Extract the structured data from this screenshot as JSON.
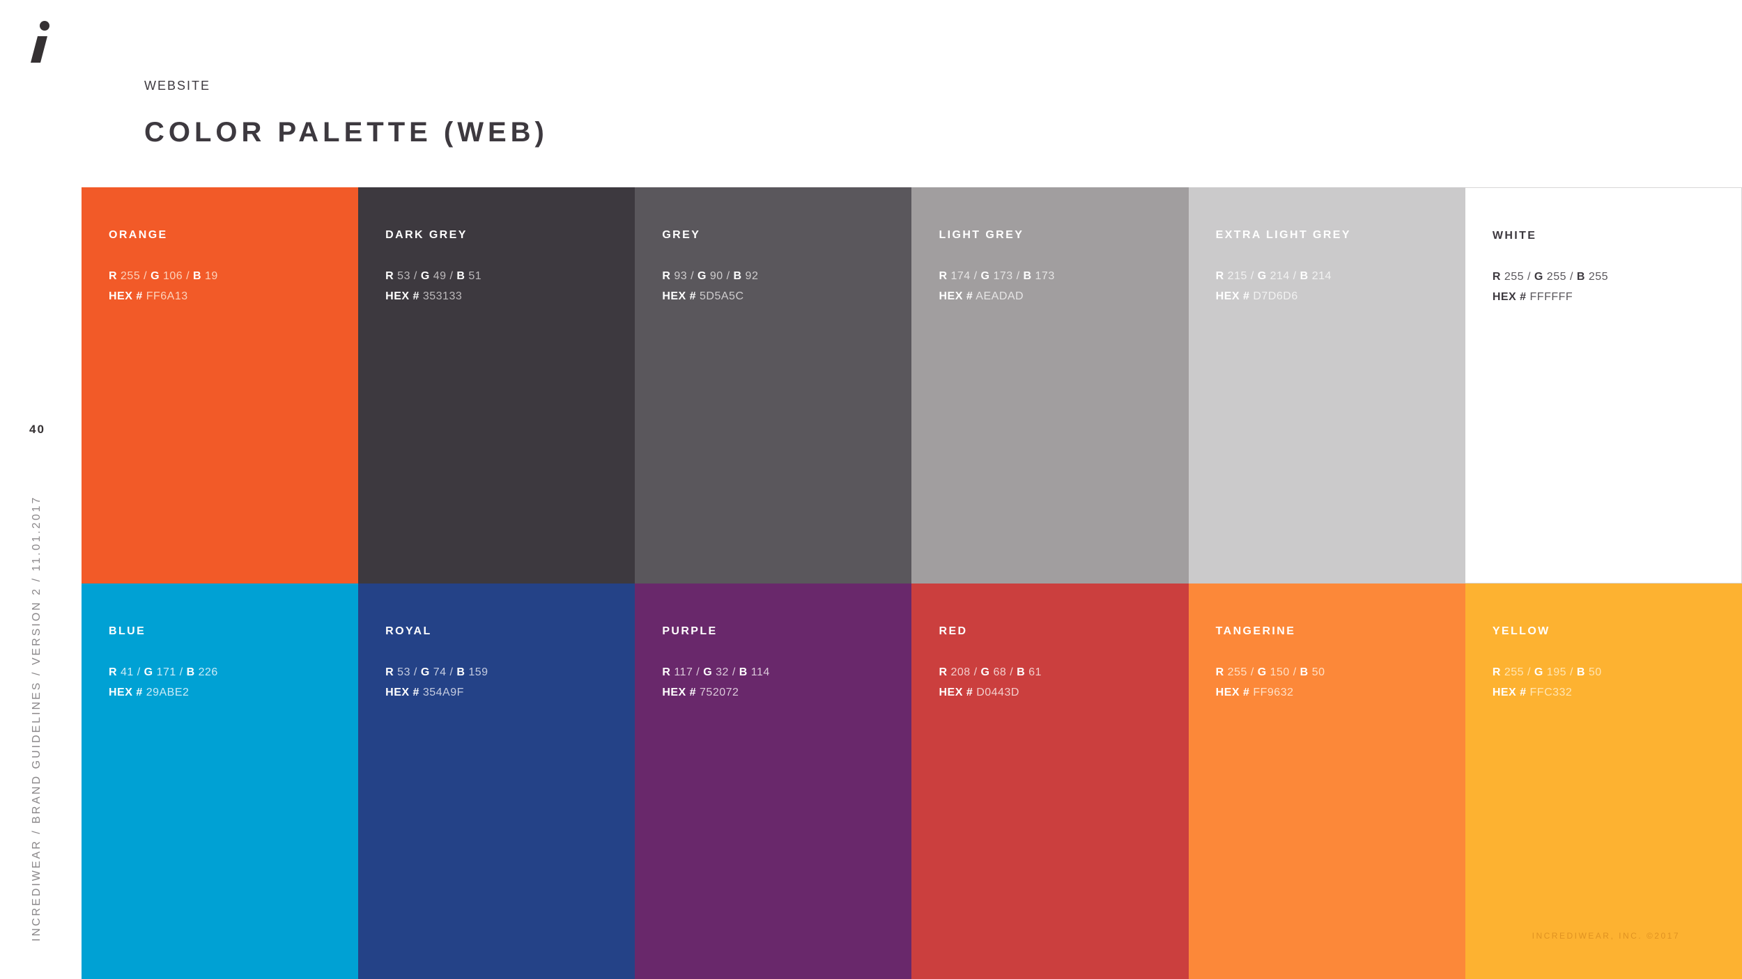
{
  "header": {
    "section_label": "WEBSITE",
    "title": "COLOR PALETTE (WEB)"
  },
  "sidebar": {
    "page_number": "40",
    "credit": "INCREDIWEAR  /  BRAND GUIDELINES  /  VERSION 2  /  11.01.2017"
  },
  "logo": {
    "icon": "italic-i-logo-icon",
    "color": "#353133"
  },
  "footer": {
    "copyright": "INCREDIWEAR, INC. ©2017"
  },
  "swatches": [
    {
      "name": "ORANGE",
      "r": "255",
      "g": "106",
      "b": "19",
      "hex": "FF6A13",
      "color": "#f25a28",
      "label_color": "#ffffff",
      "value_color": "#fcd3bd"
    },
    {
      "name": "DARK GREY",
      "r": "53",
      "g": "49",
      "b": "51",
      "hex": "353133",
      "color": "#3d393f",
      "label_color": "#ffffff",
      "value_color": "#bdbabc"
    },
    {
      "name": "GREY",
      "r": "93",
      "g": "90",
      "b": "92",
      "hex": "5D5A5C",
      "color": "#5a575c",
      "label_color": "#ffffff",
      "value_color": "#cfcdce"
    },
    {
      "name": "LIGHT GREY",
      "r": "174",
      "g": "173",
      "b": "173",
      "hex": "AEADAD",
      "color": "#a19e9f",
      "label_color": "#ffffff",
      "value_color": "#e6e5e5"
    },
    {
      "name": "EXTRA LIGHT GREY",
      "r": "215",
      "g": "214",
      "b": "214",
      "hex": "D7D6D6",
      "color": "#cbcacb",
      "label_color": "#ffffff",
      "value_color": "#f2f2f2"
    },
    {
      "name": "WHITE",
      "r": "255",
      "g": "255",
      "b": "255",
      "hex": "FFFFFF",
      "color": "#ffffff",
      "label_color": "#3d393f",
      "value_color": "#5a575c"
    },
    {
      "name": "BLUE",
      "r": "41",
      "g": "171",
      "b": "226",
      "hex": "29ABE2",
      "color": "#00a1d4",
      "label_color": "#ffffff",
      "value_color": "#cdecf7"
    },
    {
      "name": "ROYAL",
      "r": "53",
      "g": "74",
      "b": "159",
      "hex": "354A9F",
      "color": "#244287",
      "label_color": "#ffffff",
      "value_color": "#c6cde1"
    },
    {
      "name": "PURPLE",
      "r": "117",
      "g": "32",
      "b": "114",
      "hex": "752072",
      "color": "#69286b",
      "label_color": "#ffffff",
      "value_color": "#dccadb"
    },
    {
      "name": "RED",
      "r": "208",
      "g": "68",
      "b": "61",
      "hex": "D0443D",
      "color": "#cb3f3e",
      "label_color": "#ffffff",
      "value_color": "#f3cfcd"
    },
    {
      "name": "TANGERINE",
      "r": "255",
      "g": "150",
      "b": "50",
      "hex": "FF9632",
      "color": "#fc8839",
      "label_color": "#ffffff",
      "value_color": "#ffe0c6"
    },
    {
      "name": "YELLOW",
      "r": "255",
      "g": "195",
      "b": "50",
      "hex": "FFC332",
      "color": "#fdb231",
      "label_color": "#ffffff",
      "value_color": "#ffe5b3"
    }
  ]
}
